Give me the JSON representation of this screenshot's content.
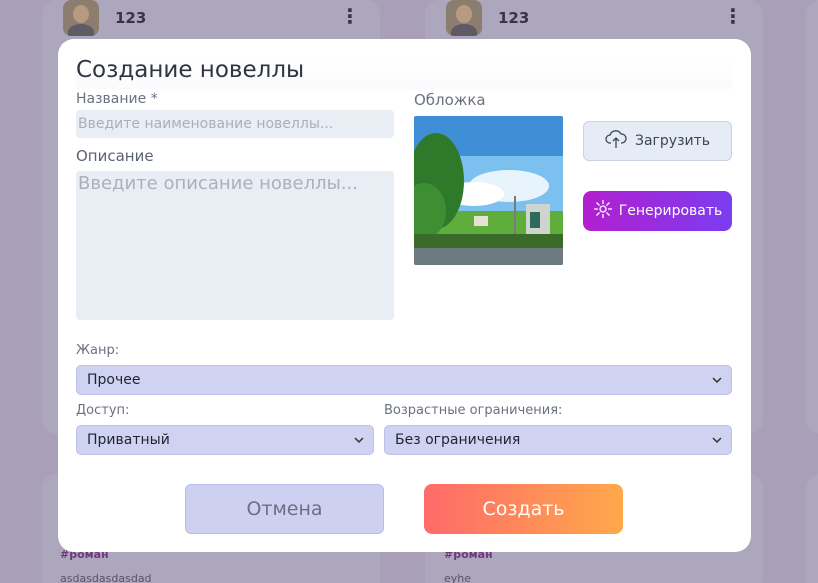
{
  "background": {
    "cards": [
      {
        "user_name": "123",
        "tag": "#роман",
        "description": "asdasdasdasdad"
      },
      {
        "user_name": "123",
        "tag": "#роман",
        "description": "eyhe"
      }
    ],
    "menu_glyph": "⋮"
  },
  "modal": {
    "title": "Создание новеллы",
    "name": {
      "label": "Название *",
      "placeholder": "Введите наименование новеллы..."
    },
    "description": {
      "label": "Описание",
      "placeholder": "Введите описание новеллы..."
    },
    "cover": {
      "label": "Обложка",
      "upload_label": "Загрузить",
      "generate_label": "Генерировать"
    },
    "genre": {
      "label": "Жанр:",
      "value": "Прочее"
    },
    "access": {
      "label": "Доступ:",
      "value": "Приватный"
    },
    "age": {
      "label": "Возрастные ограничения:",
      "value": "Без ограничения"
    },
    "cancel_label": "Отмена",
    "create_label": "Создать"
  },
  "colors": {
    "accent_generate_start": "#b21fcf",
    "accent_generate_end": "#7b3df0",
    "create_start": "#ff6a6a",
    "create_end": "#ffa84a",
    "select_bg": "#cfd3f1"
  }
}
